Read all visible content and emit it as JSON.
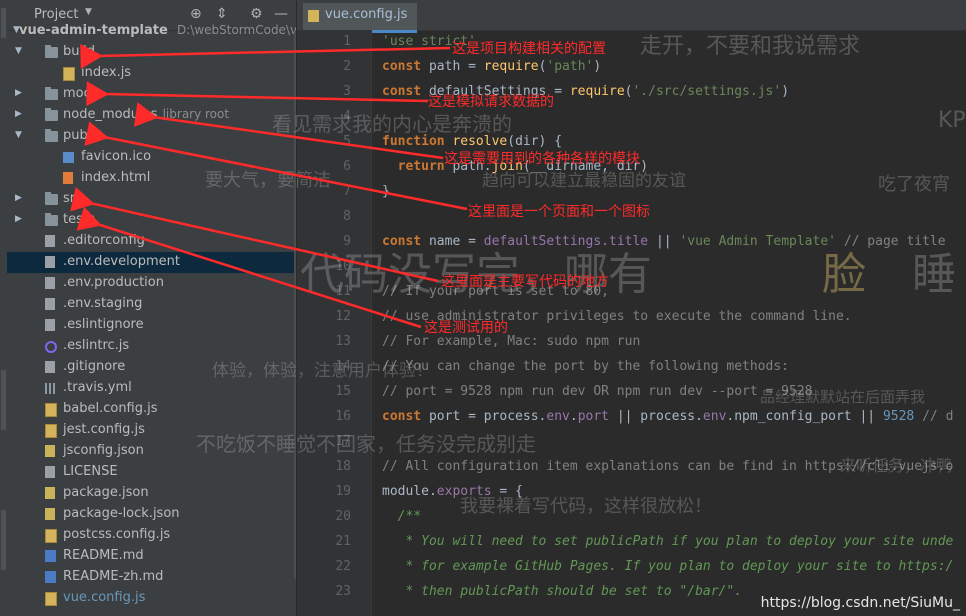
{
  "project_panel": {
    "title": "Project",
    "root": {
      "name": "vue-admin-template",
      "path": "D:\\webStormCode\\v"
    },
    "items": [
      {
        "label": "build",
        "type": "folder",
        "open": true
      },
      {
        "label": "index.js",
        "type": "js"
      },
      {
        "label": "mock",
        "type": "folder"
      },
      {
        "label": "node_modules",
        "type": "folder",
        "hint": "library root"
      },
      {
        "label": "public",
        "type": "folder",
        "open": true
      },
      {
        "label": "favicon.ico",
        "type": "png"
      },
      {
        "label": "index.html",
        "type": "html"
      },
      {
        "label": "src",
        "type": "folder"
      },
      {
        "label": "tests",
        "type": "folder"
      },
      {
        "label": ".editorconfig",
        "type": "txt"
      },
      {
        "label": ".env.development",
        "type": "txt",
        "selected": true
      },
      {
        "label": ".env.production",
        "type": "txt"
      },
      {
        "label": ".env.staging",
        "type": "txt"
      },
      {
        "label": ".eslintignore",
        "type": "txt"
      },
      {
        "label": ".eslintrc.js",
        "type": "circle"
      },
      {
        "label": ".gitignore",
        "type": "txt"
      },
      {
        "label": ".travis.yml",
        "type": "grid"
      },
      {
        "label": "babel.config.js",
        "type": "js"
      },
      {
        "label": "jest.config.js",
        "type": "js"
      },
      {
        "label": "jsconfig.json",
        "type": "json"
      },
      {
        "label": "LICENSE",
        "type": "txt"
      },
      {
        "label": "package.json",
        "type": "json"
      },
      {
        "label": "package-lock.json",
        "type": "json"
      },
      {
        "label": "postcss.config.js",
        "type": "js"
      },
      {
        "label": "README.md",
        "type": "md"
      },
      {
        "label": "README-zh.md",
        "type": "md"
      },
      {
        "label": "vue.config.js",
        "type": "js"
      }
    ]
  },
  "editor": {
    "tab": "vue.config.js",
    "line_numbers": [
      "1",
      "2",
      "3",
      "4",
      "5",
      "6",
      "7",
      "8",
      "9",
      "10",
      "11",
      "12",
      "13",
      "14",
      "15",
      "16",
      "17",
      "18",
      "19",
      "20",
      "21",
      "22",
      "23"
    ],
    "code": {
      "l1": "'use strict'",
      "l2_kw": "const",
      "l2_a": " path = ",
      "l2_fn": "require",
      "l2_b": "(",
      "l2_str": "'path'",
      "l2_c": ")",
      "l3_kw": "const",
      "l3_a": " defaultSettings = ",
      "l3_fn": "require",
      "l3_b": "(",
      "l3_str": "'./src/settings.js'",
      "l3_c": ")",
      "l5_kw": "function",
      "l5_fn": " resolve",
      "l5_a": "(dir) {",
      "l6_kw": "  return",
      "l6_a": " path.",
      "l6_fn": "join",
      "l6_b": "(__dirname, dir)",
      "l7": "}",
      "l9_kw": "const",
      "l9_a": " name = ",
      "l9_prop": "defaultSettings.title",
      "l9_b": " || ",
      "l9_str": "'vue Admin Template'",
      "l9_cm": " // page title",
      "l11": "// If your port is set to 80,",
      "l12": "// use administrator privileges to execute the command line.",
      "l13": "// For example, Mac: sudo npm run",
      "l14": "// You can change the port by the following methods:",
      "l15": "// port = 9528 npm run dev OR npm run dev --port = 9528",
      "l16_kw": "const",
      "l16_a": " port = process.",
      "l16_p1": "env",
      "l16_b": ".",
      "l16_p2": "port",
      "l16_c": " || process.",
      "l16_p3": "env",
      "l16_d": ".npm_config_port || ",
      "l16_num": "9528",
      "l16_cm": " // d",
      "l18": "// All configuration item explanations can be find in https://cli.vuejs.o",
      "l19_a": "module.",
      "l19_prop": "exports",
      "l19_b": " = {",
      "l20": "  /**",
      "l21": "   * You will need to set publicPath if you plan to deploy your site unde",
      "l22": "   * for example GitHub Pages. If you plan to deploy your site to https:/",
      "l23": "   * then publicPath should be set to \"/bar/\"."
    }
  },
  "annotations": {
    "build": "这是项目构建相关的配置",
    "mock": "这是模拟请求数据的",
    "node_modules": "这是需要用到的各种各样的模块",
    "public": "这里面是一个页面和一个图标",
    "src": "这里面是主要写代码的地方",
    "tests": "这是测试用的"
  },
  "watermarks": {
    "w1": "走开，不要和我说需求",
    "w2": "看见需求我的内心是奔溃的",
    "w3": "KP",
    "w4": "要大气，要简洁",
    "w5": "趋向可以建立最稳固的友谊",
    "w6": "吃了夜宵",
    "w7": "代码没写完，哪有",
    "w7b": "脸",
    "w7c": "睡",
    "w8": "体验，体验，注意用户体验！",
    "w9": "品经理默默站在后面弄我",
    "w10": "不吃饭不睡觉不回家，任务没完成别走",
    "w11": "来听任务，冲鸭",
    "w12": "我要裸着写代码，这样很放松！"
  },
  "credit": "https://blog.csdn.net/SiuMu_",
  "colors": {
    "annotation": "#ff2a2a",
    "selected_row": "#0d293e",
    "keyword": "#cc7832"
  }
}
